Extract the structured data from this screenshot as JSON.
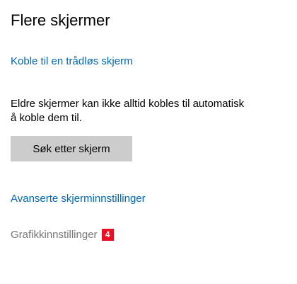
{
  "section": {
    "title": "Flere skjermer"
  },
  "links": {
    "wireless_display": "Koble til en trådløs skjerm",
    "advanced_display_settings": "Avanserte skjerminnstillinger"
  },
  "description": {
    "line1": "Eldre skjermer kan ikke alltid kobles til automatisk",
    "line2": "å koble dem til."
  },
  "buttons": {
    "detect": "Søk etter skjerm"
  },
  "graphics": {
    "label": "Grafikkinnstillinger",
    "badge": "4"
  },
  "colors": {
    "link": "#0067b8",
    "button_bg": "#cccccc",
    "muted_text": "#767676",
    "badge_bg": "#e81123"
  }
}
